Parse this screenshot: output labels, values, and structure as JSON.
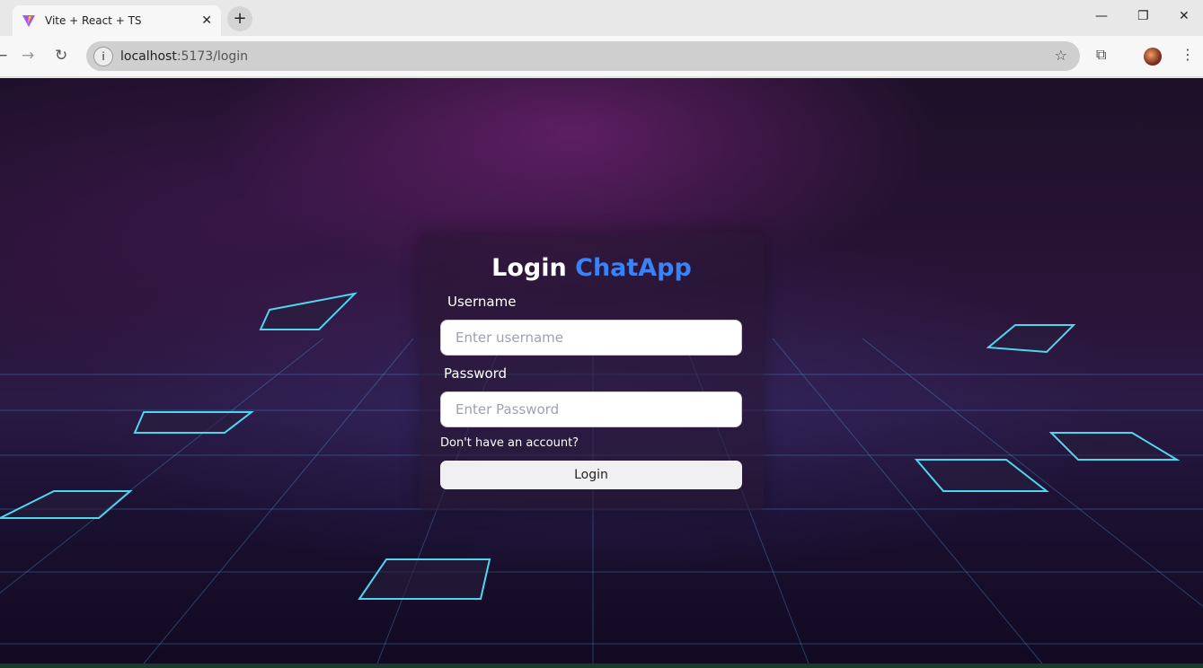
{
  "browser": {
    "tab_title": "Vite + React + TS",
    "tab_close": "✕",
    "new_tab": "+",
    "url_host": "localhost",
    "url_rest": ":5173/login",
    "icons": [
      "vite-logo-icon",
      "close-icon",
      "plus-icon",
      "back-icon",
      "forward-icon",
      "reload-icon",
      "info-icon",
      "star-icon",
      "extensions-icon",
      "avatar",
      "more-vert-icon",
      "minimize-icon",
      "restore-icon",
      "close-window-icon"
    ]
  },
  "login": {
    "title": "Login",
    "brand": "ChatApp",
    "username_label": "Username",
    "username_placeholder": "Enter username",
    "password_label": "Password",
    "password_placeholder": "Enter Password",
    "signup_link": "Don't have an account?",
    "submit_label": "Login",
    "brand_color": "#3b82f6"
  }
}
